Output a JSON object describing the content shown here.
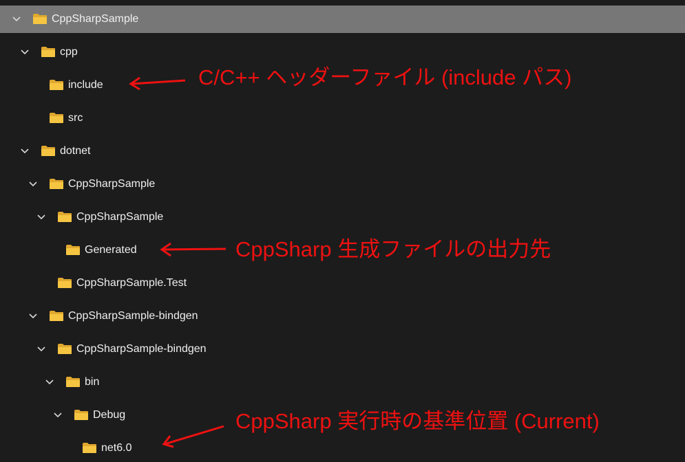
{
  "tree": {
    "rows": [
      {
        "label": "CppSharpSample",
        "level": 0,
        "expanded": true,
        "selected": true
      },
      {
        "label": "cpp",
        "level": 1,
        "expanded": true
      },
      {
        "label": "include",
        "level": 2,
        "expanded": false
      },
      {
        "label": "src",
        "level": 2,
        "expanded": false
      },
      {
        "label": "dotnet",
        "level": 1,
        "expanded": true
      },
      {
        "label": "CppSharpSample",
        "level": 2,
        "expanded": true
      },
      {
        "label": "CppSharpSample",
        "level": 3,
        "expanded": true
      },
      {
        "label": "Generated",
        "level": 4,
        "expanded": false
      },
      {
        "label": "CppSharpSample.Test",
        "level": 3,
        "expanded": false
      },
      {
        "label": "CppSharpSample-bindgen",
        "level": 2,
        "expanded": true
      },
      {
        "label": "CppSharpSample-bindgen",
        "level": 3,
        "expanded": true
      },
      {
        "label": "bin",
        "level": 4,
        "expanded": true
      },
      {
        "label": "Debug",
        "level": 5,
        "expanded": true
      },
      {
        "label": "net6.0",
        "level": 6,
        "expanded": false
      }
    ]
  },
  "annotations": {
    "include_note": "C/C++ ヘッダーファイル (include パス)",
    "generated_note": "CppSharp 生成ファイルの出力先",
    "current_note": "CppSharp 実行時の基準位置 (Current)"
  },
  "colors": {
    "background": "#1c1c1c",
    "selected_row": "#777777",
    "text": "#f0f0f0",
    "annotation": "#ee1111",
    "folder_body": "#f5c542",
    "folder_tab": "#e0a82e"
  },
  "icons": {
    "expand": "chevron-down-icon",
    "folder": "folder-icon"
  }
}
